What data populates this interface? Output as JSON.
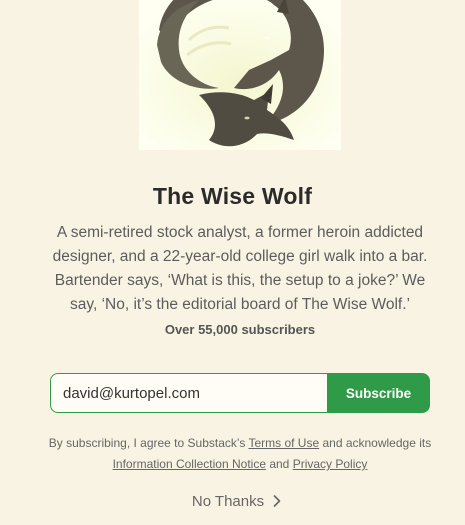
{
  "publication": {
    "name": "The Wise Wolf",
    "description": "A semi-retired stock analyst, a former heroin addicted designer, and a 22-year-old college girl walk into a bar. Bartender says, ‘What is this, the setup to a joke?’ We say, ‘No, it’s the editorial board of The Wise Wolf.’",
    "subscriber_count": "Over 55,000 subscribers",
    "logo_icon": "wolf-yin-yang-logo-icon"
  },
  "form": {
    "email_value": "david@kurtopel.com",
    "subscribe_label": "Subscribe",
    "accent_color": "#2f9a47"
  },
  "legal": {
    "text_1": "By subscribing, I agree to Substack’s ",
    "terms_link": "Terms of Use",
    "text_2": " and acknowledge its ",
    "info_link": "Information Collection Notice",
    "text_3": " and ",
    "privacy_link": "Privacy Policy"
  },
  "footer": {
    "no_thanks_label": "No Thanks",
    "chevron_icon": "chevron-right-icon"
  }
}
